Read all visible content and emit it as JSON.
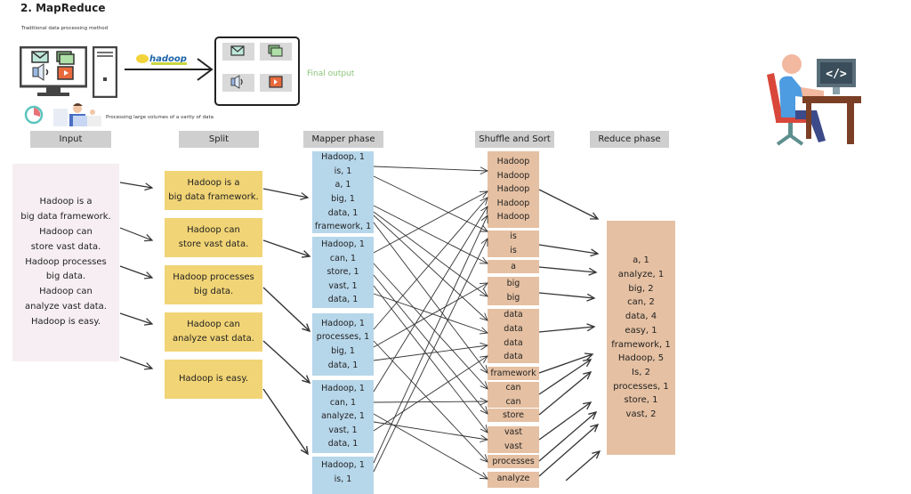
{
  "page": {
    "title": "2. MapReduce",
    "traditional_label": "Traditional data processing method",
    "caption": "Processing large volumes of a varity of data",
    "hadoop_logo_text": "hadoop",
    "final_output_label": "Final output"
  },
  "colors": {
    "input_bg": "#f6eef2",
    "split_bg": "#f1d475",
    "mapper_bg": "#b6d6ea",
    "shuffle_bg": "#e5c0a2",
    "reduce_bg": "#e5c0a2",
    "header_bg": "#cfcfcf",
    "final_output": "#8bc47a"
  },
  "headers": {
    "input": "Input",
    "split": "Split",
    "mapper": "Mapper phase",
    "shuffle": "Shuffle and Sort",
    "reduce": "Reduce phase"
  },
  "input": {
    "text": "Hadoop is a\nbig data framework.\nHadoop can\nstore vast data.\nHadoop processes\nbig data.\nHadoop can\nanalyze vast data.\nHadoop is easy."
  },
  "split": [
    "Hadoop is a\nbig data framework.",
    "Hadoop can\nstore vast data.",
    "Hadoop processes\nbig data.",
    "Hadoop can\nanalyze vast data.",
    "Hadoop is easy."
  ],
  "mapper": [
    [
      "Hadoop, 1",
      "is, 1",
      "a, 1",
      "big, 1",
      "data, 1",
      "framework, 1"
    ],
    [
      "Hadoop, 1",
      "can, 1",
      "store, 1",
      "vast, 1",
      "data, 1"
    ],
    [
      "Hadoop, 1",
      "processes, 1",
      "big, 1",
      "data, 1"
    ],
    [
      "Hadoop, 1",
      "can, 1",
      "analyze, 1",
      "vast, 1",
      "data, 1"
    ],
    [
      "Hadoop, 1",
      "is, 1"
    ]
  ],
  "shuffle": [
    [
      "Hadoop",
      "Hadoop",
      "Hadoop",
      "Hadoop",
      "Hadoop"
    ],
    [
      "is",
      "is"
    ],
    [
      "a"
    ],
    [
      "big",
      "big"
    ],
    [
      "data",
      "data",
      "data",
      "data"
    ],
    [
      "framework"
    ],
    [
      "can",
      "can"
    ],
    [
      "store"
    ],
    [
      "vast",
      "vast"
    ],
    [
      "processes"
    ],
    [
      "analyze"
    ]
  ],
  "reduce": [
    "a, 1",
    "analyze, 1",
    "big, 2",
    "can, 2",
    "data, 4",
    "easy, 1",
    "framework, 1",
    "Hadoop, 5",
    "Is, 2",
    "processes, 1",
    "store, 1",
    "vast, 2"
  ],
  "icons": {
    "computer": "desktop-monitor-icon",
    "tower": "pc-tower-icon",
    "mail": "mail-icon",
    "image": "image-icon",
    "audio": "speaker-icon",
    "video": "video-icon",
    "clock": "clock-icon",
    "person": "stressed-person-icon",
    "developer": "developer-at-desk-icon"
  }
}
